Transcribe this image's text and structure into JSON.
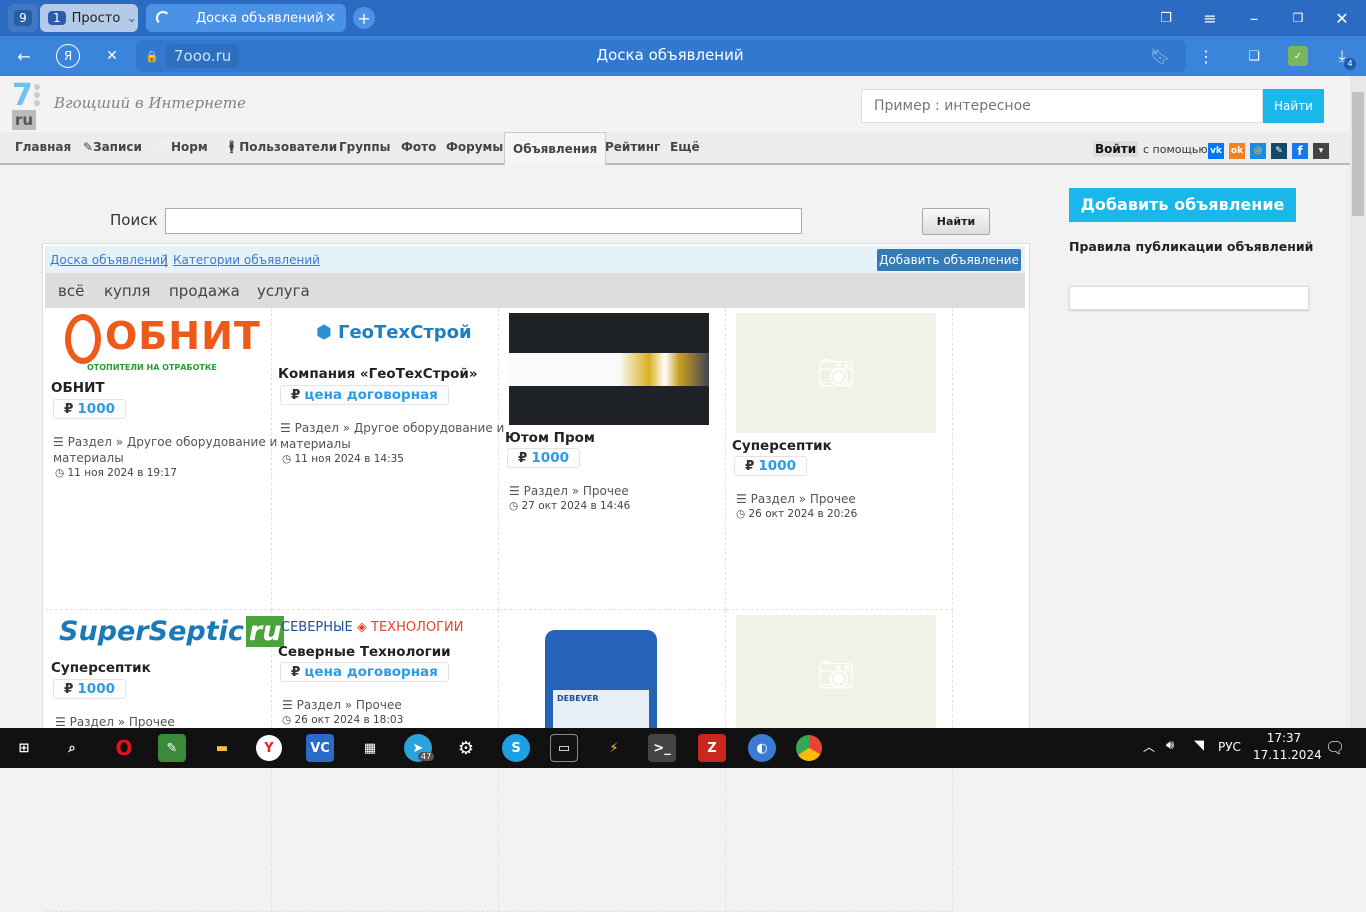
{
  "browser": {
    "tab_count": "9",
    "group_tab": {
      "count": "1",
      "label": "Просто"
    },
    "active_tab": "Доска объявлений",
    "url": "7ooo.ru",
    "page_title": "Доска объявлений",
    "downloads_badge": "4"
  },
  "site": {
    "logo_top": "7",
    "logo_bottom": "ru",
    "slogan": "Вгощший в Интернете",
    "search_placeholder": "Пример : интересное",
    "search_button": "Найти",
    "nav": [
      "Главная",
      "Записи",
      "Норм",
      "Пользователи",
      "Группы",
      "Фото",
      "Форумы",
      "Объявления",
      "Рейтинг",
      "Ещё"
    ],
    "login": "Войти",
    "login_with": "с помощью:",
    "socials": [
      "vk",
      "ok",
      "mail",
      "lj",
      "fb",
      "more"
    ]
  },
  "board": {
    "search_label": "Поиск",
    "search_value": "",
    "search_button": "Найти",
    "add_button": "Добавить объявление",
    "rules_link": "Правила публикации объявлений",
    "breadcrumb": [
      "Доска объявлений",
      "Категории объявлений"
    ],
    "add_small": "Добавить объявление",
    "filters": [
      "всё",
      "купля",
      "продажа",
      "услуга"
    ],
    "cards": [
      {
        "logo": "ОБНИТ",
        "logo_sub": "ОТОПИТЕЛИ НА ОТРАБОТКЕ",
        "title": "ОБНИТ",
        "currency": "₽",
        "price": "1000",
        "category": "Раздел » Другое оборудование и материалы",
        "date": "11 ноя 2024 в 19:17"
      },
      {
        "logo": "ГеоТехСтрой",
        "title": "Компания «ГеоТехСтрой»",
        "currency": "₽",
        "price": "цена договорная",
        "category": "Раздел » Другое оборудование и материалы",
        "date": "11 ноя 2024 в 14:35"
      },
      {
        "title": "Ютом Пром",
        "currency": "₽",
        "price": "1000",
        "category": "Раздел » Прочее",
        "date": "27 окт 2024 в 14:46"
      },
      {
        "title": "Суперсептик",
        "currency": "₽",
        "price": "1000",
        "category": "Раздел » Прочее",
        "date": "26 окт 2024 в 20:26"
      },
      {
        "logo": "SuperSeptic",
        "logo_ru": "ru",
        "title": "Суперсептик",
        "currency": "₽",
        "price": "1000",
        "category": "Раздел » Прочее"
      },
      {
        "logo": "СЕВЕРНЫЕ",
        "logo2": "ТЕХНОЛОГИИ",
        "title": "Северные Технологии",
        "currency": "₽",
        "price": "цена договорная",
        "category": "Раздел » Прочее",
        "date": "26 окт 2024 в 18:03"
      },
      {
        "logo": "DEBEVER"
      },
      {}
    ]
  },
  "taskbar": {
    "telegram_badge": "47",
    "lang": "РУС",
    "time": "17:37",
    "date": "17.11.2024"
  }
}
